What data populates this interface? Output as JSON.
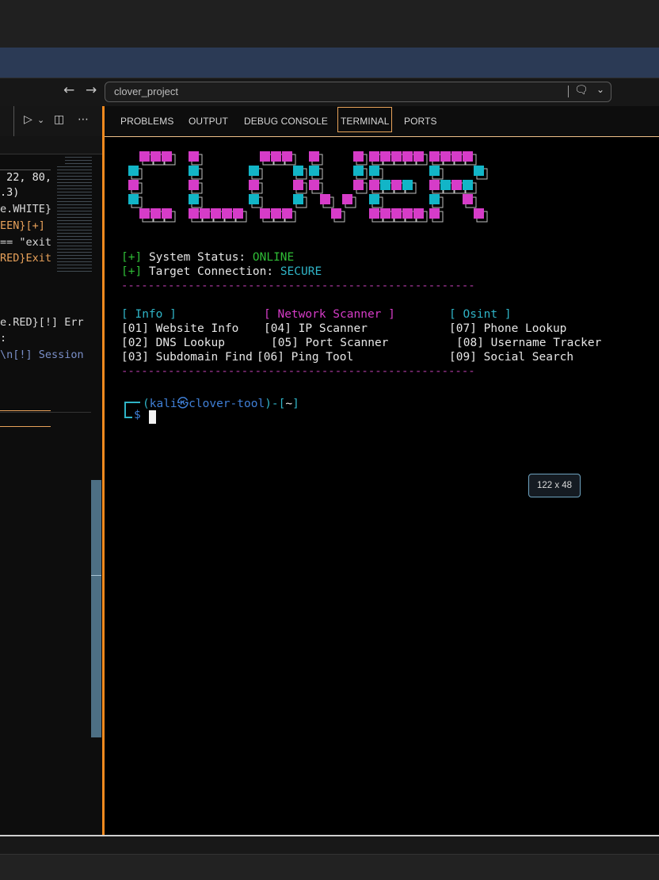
{
  "search": {
    "value": "clover_project"
  },
  "panel_tabs": [
    "PROBLEMS",
    "OUTPUT",
    "DEBUG CONSOLE",
    "TERMINAL",
    "PORTS"
  ],
  "active_tab": "TERMINAL",
  "editor_lines": [
    {
      "text": " 22, 80,",
      "color": "#e8e8e8"
    },
    {
      "text": ".3)",
      "color": "#e8e8e8"
    },
    {
      "text": "e.WHITE}",
      "color": "#d8d8d8"
    },
    {
      "text": "EEN}[+]",
      "color": "#e8a15a"
    },
    {
      "text": "== \"exit",
      "color": "#d8d8d8"
    },
    {
      "text": "RED}Exit",
      "color": "#e8a15a"
    },
    {
      "text": "e.RED}[!] Err",
      "color": "#d8d8d8"
    },
    {
      "text": ":",
      "color": "#d8d8d8"
    },
    {
      "text": "\\n[!] Session",
      "color": "#7a8fc8"
    }
  ],
  "terminal": {
    "logo_text": "CLOVER",
    "status_prefix": "[+]",
    "status_label": "System Status: ",
    "status_value": "ONLINE",
    "conn_prefix": "[+]",
    "conn_label": "Target Connection: ",
    "conn_value": "SECURE",
    "divider": "-----------------------------------------------------",
    "col_info": "[ Info ]",
    "col_network": "[ Network Scanner ]",
    "col_osint": "[ Osint ]",
    "menu": {
      "m01": "[01] Website Info",
      "m02": "[02] DNS Lookup",
      "m03": "[03] Subdomain Find",
      "m04": "[04] IP Scanner",
      "m05": "[05] Port Scanner",
      "m06": "[06] Ping Tool",
      "m07": "[07] Phone Lookup",
      "m08": "[08] Username Tracker",
      "m09": "[09] Social Search"
    },
    "prompt_open": "(",
    "prompt_user": "kali",
    "prompt_at": "㉿",
    "prompt_host": "clover-tool",
    "prompt_close": ")-[",
    "prompt_dir": "~",
    "prompt_end": "]",
    "prompt_symbol": "$"
  },
  "size_tooltip": "122 x 48",
  "colors": {
    "accent_border": "#f28a1f",
    "logo_magenta": "#d63cc8",
    "logo_cyan": "#12b5c7",
    "online_green": "#2fbd36",
    "secure_cyan": "#2fb4c7"
  }
}
